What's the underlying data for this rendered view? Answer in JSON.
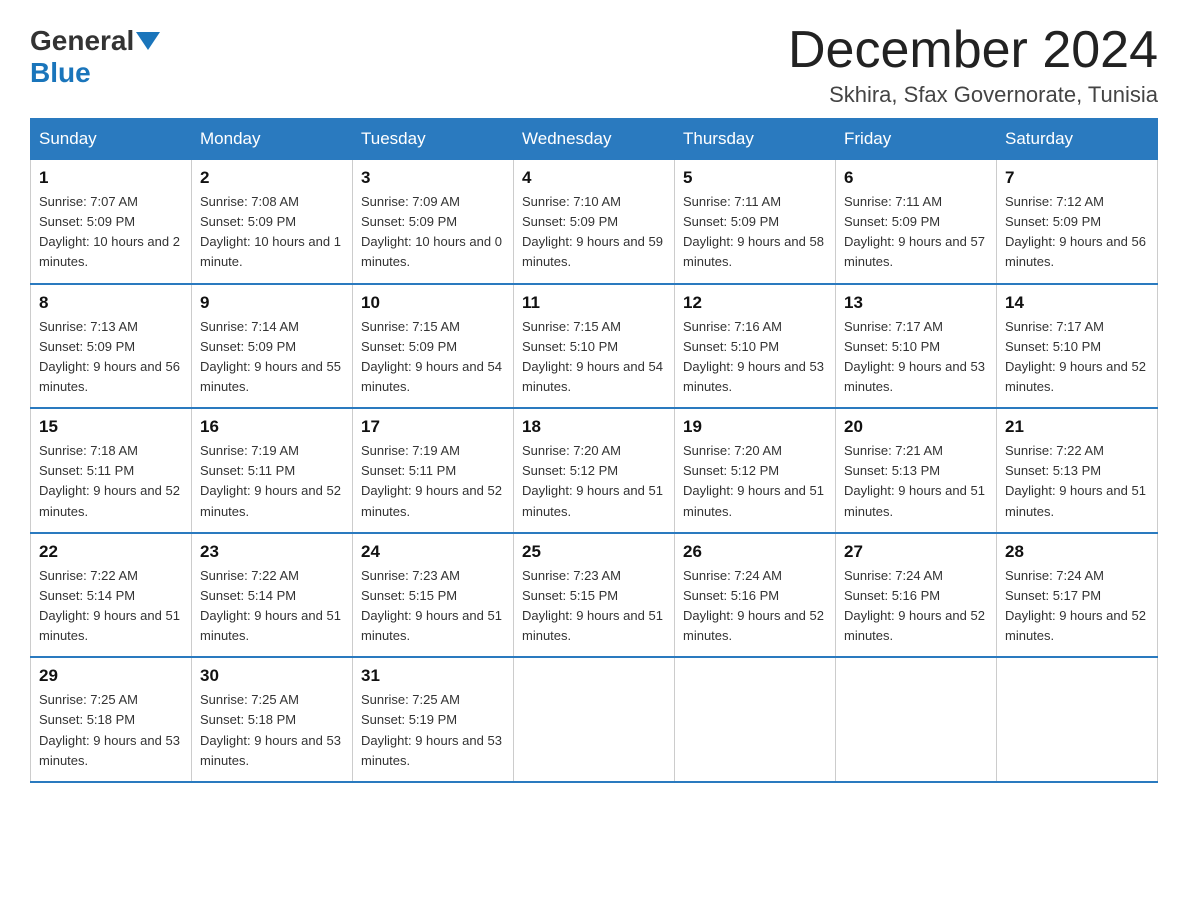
{
  "header": {
    "logo": {
      "general": "General",
      "blue": "Blue"
    },
    "title": "December 2024",
    "location": "Skhira, Sfax Governorate, Tunisia"
  },
  "calendar": {
    "days_of_week": [
      "Sunday",
      "Monday",
      "Tuesday",
      "Wednesday",
      "Thursday",
      "Friday",
      "Saturday"
    ],
    "weeks": [
      [
        {
          "day": 1,
          "sunrise": "7:07 AM",
          "sunset": "5:09 PM",
          "daylight": "10 hours and 2 minutes."
        },
        {
          "day": 2,
          "sunrise": "7:08 AM",
          "sunset": "5:09 PM",
          "daylight": "10 hours and 1 minute."
        },
        {
          "day": 3,
          "sunrise": "7:09 AM",
          "sunset": "5:09 PM",
          "daylight": "10 hours and 0 minutes."
        },
        {
          "day": 4,
          "sunrise": "7:10 AM",
          "sunset": "5:09 PM",
          "daylight": "9 hours and 59 minutes."
        },
        {
          "day": 5,
          "sunrise": "7:11 AM",
          "sunset": "5:09 PM",
          "daylight": "9 hours and 58 minutes."
        },
        {
          "day": 6,
          "sunrise": "7:11 AM",
          "sunset": "5:09 PM",
          "daylight": "9 hours and 57 minutes."
        },
        {
          "day": 7,
          "sunrise": "7:12 AM",
          "sunset": "5:09 PM",
          "daylight": "9 hours and 56 minutes."
        }
      ],
      [
        {
          "day": 8,
          "sunrise": "7:13 AM",
          "sunset": "5:09 PM",
          "daylight": "9 hours and 56 minutes."
        },
        {
          "day": 9,
          "sunrise": "7:14 AM",
          "sunset": "5:09 PM",
          "daylight": "9 hours and 55 minutes."
        },
        {
          "day": 10,
          "sunrise": "7:15 AM",
          "sunset": "5:09 PM",
          "daylight": "9 hours and 54 minutes."
        },
        {
          "day": 11,
          "sunrise": "7:15 AM",
          "sunset": "5:10 PM",
          "daylight": "9 hours and 54 minutes."
        },
        {
          "day": 12,
          "sunrise": "7:16 AM",
          "sunset": "5:10 PM",
          "daylight": "9 hours and 53 minutes."
        },
        {
          "day": 13,
          "sunrise": "7:17 AM",
          "sunset": "5:10 PM",
          "daylight": "9 hours and 53 minutes."
        },
        {
          "day": 14,
          "sunrise": "7:17 AM",
          "sunset": "5:10 PM",
          "daylight": "9 hours and 52 minutes."
        }
      ],
      [
        {
          "day": 15,
          "sunrise": "7:18 AM",
          "sunset": "5:11 PM",
          "daylight": "9 hours and 52 minutes."
        },
        {
          "day": 16,
          "sunrise": "7:19 AM",
          "sunset": "5:11 PM",
          "daylight": "9 hours and 52 minutes."
        },
        {
          "day": 17,
          "sunrise": "7:19 AM",
          "sunset": "5:11 PM",
          "daylight": "9 hours and 52 minutes."
        },
        {
          "day": 18,
          "sunrise": "7:20 AM",
          "sunset": "5:12 PM",
          "daylight": "9 hours and 51 minutes."
        },
        {
          "day": 19,
          "sunrise": "7:20 AM",
          "sunset": "5:12 PM",
          "daylight": "9 hours and 51 minutes."
        },
        {
          "day": 20,
          "sunrise": "7:21 AM",
          "sunset": "5:13 PM",
          "daylight": "9 hours and 51 minutes."
        },
        {
          "day": 21,
          "sunrise": "7:22 AM",
          "sunset": "5:13 PM",
          "daylight": "9 hours and 51 minutes."
        }
      ],
      [
        {
          "day": 22,
          "sunrise": "7:22 AM",
          "sunset": "5:14 PM",
          "daylight": "9 hours and 51 minutes."
        },
        {
          "day": 23,
          "sunrise": "7:22 AM",
          "sunset": "5:14 PM",
          "daylight": "9 hours and 51 minutes."
        },
        {
          "day": 24,
          "sunrise": "7:23 AM",
          "sunset": "5:15 PM",
          "daylight": "9 hours and 51 minutes."
        },
        {
          "day": 25,
          "sunrise": "7:23 AM",
          "sunset": "5:15 PM",
          "daylight": "9 hours and 51 minutes."
        },
        {
          "day": 26,
          "sunrise": "7:24 AM",
          "sunset": "5:16 PM",
          "daylight": "9 hours and 52 minutes."
        },
        {
          "day": 27,
          "sunrise": "7:24 AM",
          "sunset": "5:16 PM",
          "daylight": "9 hours and 52 minutes."
        },
        {
          "day": 28,
          "sunrise": "7:24 AM",
          "sunset": "5:17 PM",
          "daylight": "9 hours and 52 minutes."
        }
      ],
      [
        {
          "day": 29,
          "sunrise": "7:25 AM",
          "sunset": "5:18 PM",
          "daylight": "9 hours and 53 minutes."
        },
        {
          "day": 30,
          "sunrise": "7:25 AM",
          "sunset": "5:18 PM",
          "daylight": "9 hours and 53 minutes."
        },
        {
          "day": 31,
          "sunrise": "7:25 AM",
          "sunset": "5:19 PM",
          "daylight": "9 hours and 53 minutes."
        },
        null,
        null,
        null,
        null
      ]
    ]
  }
}
